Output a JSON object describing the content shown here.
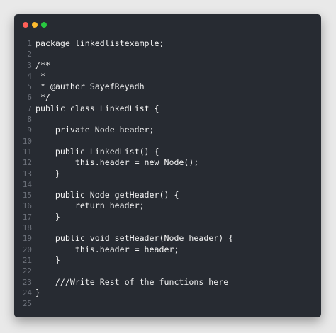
{
  "window": {
    "controls": [
      {
        "name": "close",
        "color": "#ff5f57"
      },
      {
        "name": "minimize",
        "color": "#febc2e"
      },
      {
        "name": "maximize",
        "color": "#28c840"
      }
    ]
  },
  "code": {
    "lines": [
      {
        "number": "1",
        "text": "package linkedlistexample;"
      },
      {
        "number": "2",
        "text": ""
      },
      {
        "number": "3",
        "text": "/**"
      },
      {
        "number": "4",
        "text": " *"
      },
      {
        "number": "5",
        "text": " * @author SayefReyadh"
      },
      {
        "number": "6",
        "text": " */"
      },
      {
        "number": "7",
        "text": "public class LinkedList {"
      },
      {
        "number": "8",
        "text": ""
      },
      {
        "number": "9",
        "text": "    private Node header;"
      },
      {
        "number": "10",
        "text": ""
      },
      {
        "number": "11",
        "text": "    public LinkedList() {"
      },
      {
        "number": "12",
        "text": "        this.header = new Node();"
      },
      {
        "number": "13",
        "text": "    }"
      },
      {
        "number": "14",
        "text": ""
      },
      {
        "number": "15",
        "text": "    public Node getHeader() {"
      },
      {
        "number": "16",
        "text": "        return header;"
      },
      {
        "number": "17",
        "text": "    }"
      },
      {
        "number": "18",
        "text": ""
      },
      {
        "number": "19",
        "text": "    public void setHeader(Node header) {"
      },
      {
        "number": "20",
        "text": "        this.header = header;"
      },
      {
        "number": "21",
        "text": "    }"
      },
      {
        "number": "22",
        "text": ""
      },
      {
        "number": "23",
        "text": "    ///Write Rest of the functions here"
      },
      {
        "number": "24",
        "text": "}"
      },
      {
        "number": "25",
        "text": ""
      }
    ]
  }
}
